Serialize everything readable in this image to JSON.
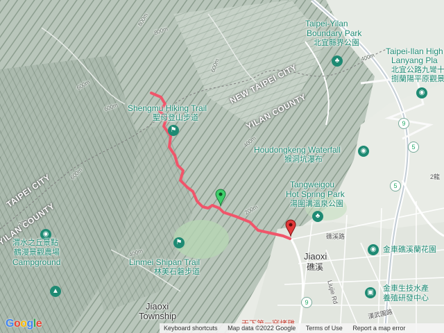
{
  "labels": {
    "taipei_yilan_boundary_en_1": "Taipei-Yilan",
    "taipei_yilan_boundary_en_2": "Boundary Park",
    "taipei_yilan_boundary_zh": "北宜縣界公園",
    "taipei_ilan_high_en_1": "Taipei-Ilan High",
    "taipei_ilan_high_en_2": "Lanyang Pla",
    "taipei_ilan_high_zh_1": "北宜公路九彎十",
    "taipei_ilan_high_zh_2": "捌蘭陽平原觀景",
    "new_taipei_city_1": "NEW TAIPEI CITY",
    "yilan_county_1": "YILAN COUNTY",
    "shenggu_trail_en": "Shengmu Hiking Trail",
    "shenggu_trail_zh": "聖母登山步道",
    "houdongkeng_en": "Houdongkeng Waterfall",
    "houdongkeng_zh": "猴洞坑瀑布",
    "tangweigou_en_1": "Tangweigou",
    "tangweigou_en_2": "Hot Spring Park",
    "tangweigou_zh": "湯圍溝溫泉公園",
    "taipei_city_2": "TAIPEI CITY",
    "yilan_county_2": "YILAN COUNTY",
    "jiaoxi_viewpoint_zh": "渭水之丘景點",
    "campground_zh": "鶴漫景觀農場",
    "campground_en": "Campground",
    "linmei_en": "Linmei Shipan Trail",
    "linmei_zh": "林美石磐步道",
    "jiaoxi_en": "Jiaoxi",
    "jiaoxi_zh": "礁溪",
    "jiaoxi_township_en_1": "Jiaoxi",
    "jiaoxi_township_en_2": "Township",
    "jinche_orchid_zh": "金車礁溪蘭花園",
    "jinche_bio_zh_1": "金車生技水產",
    "jinche_bio_zh_2": "養殖研發中心",
    "tianxia_zh": "天下第一窯烤雞",
    "liujie_rd": "Liujie Rd",
    "youwu_rd": "漢武園路",
    "jiaoxi_rd": "礁溪路",
    "er_long": "2龍"
  },
  "contours": [
    "800m",
    "600m",
    "600m",
    "800m",
    "600m",
    "400m",
    "600m",
    "400m",
    "200m",
    "200m",
    "400m"
  ],
  "shields": [
    "9",
    "5",
    "9",
    "5",
    "9",
    "9"
  ],
  "attribution": {
    "logo": "Google",
    "keyboard": "Keyboard shortcuts",
    "mapdata": "Map data ©2022 Google",
    "terms": "Terms of Use",
    "report": "Report a map error"
  },
  "colors": {
    "route": "#f0556a",
    "start_pin": "#3fcf6b",
    "end_pin": "#e23a3a",
    "poi": "#1e8a73"
  }
}
